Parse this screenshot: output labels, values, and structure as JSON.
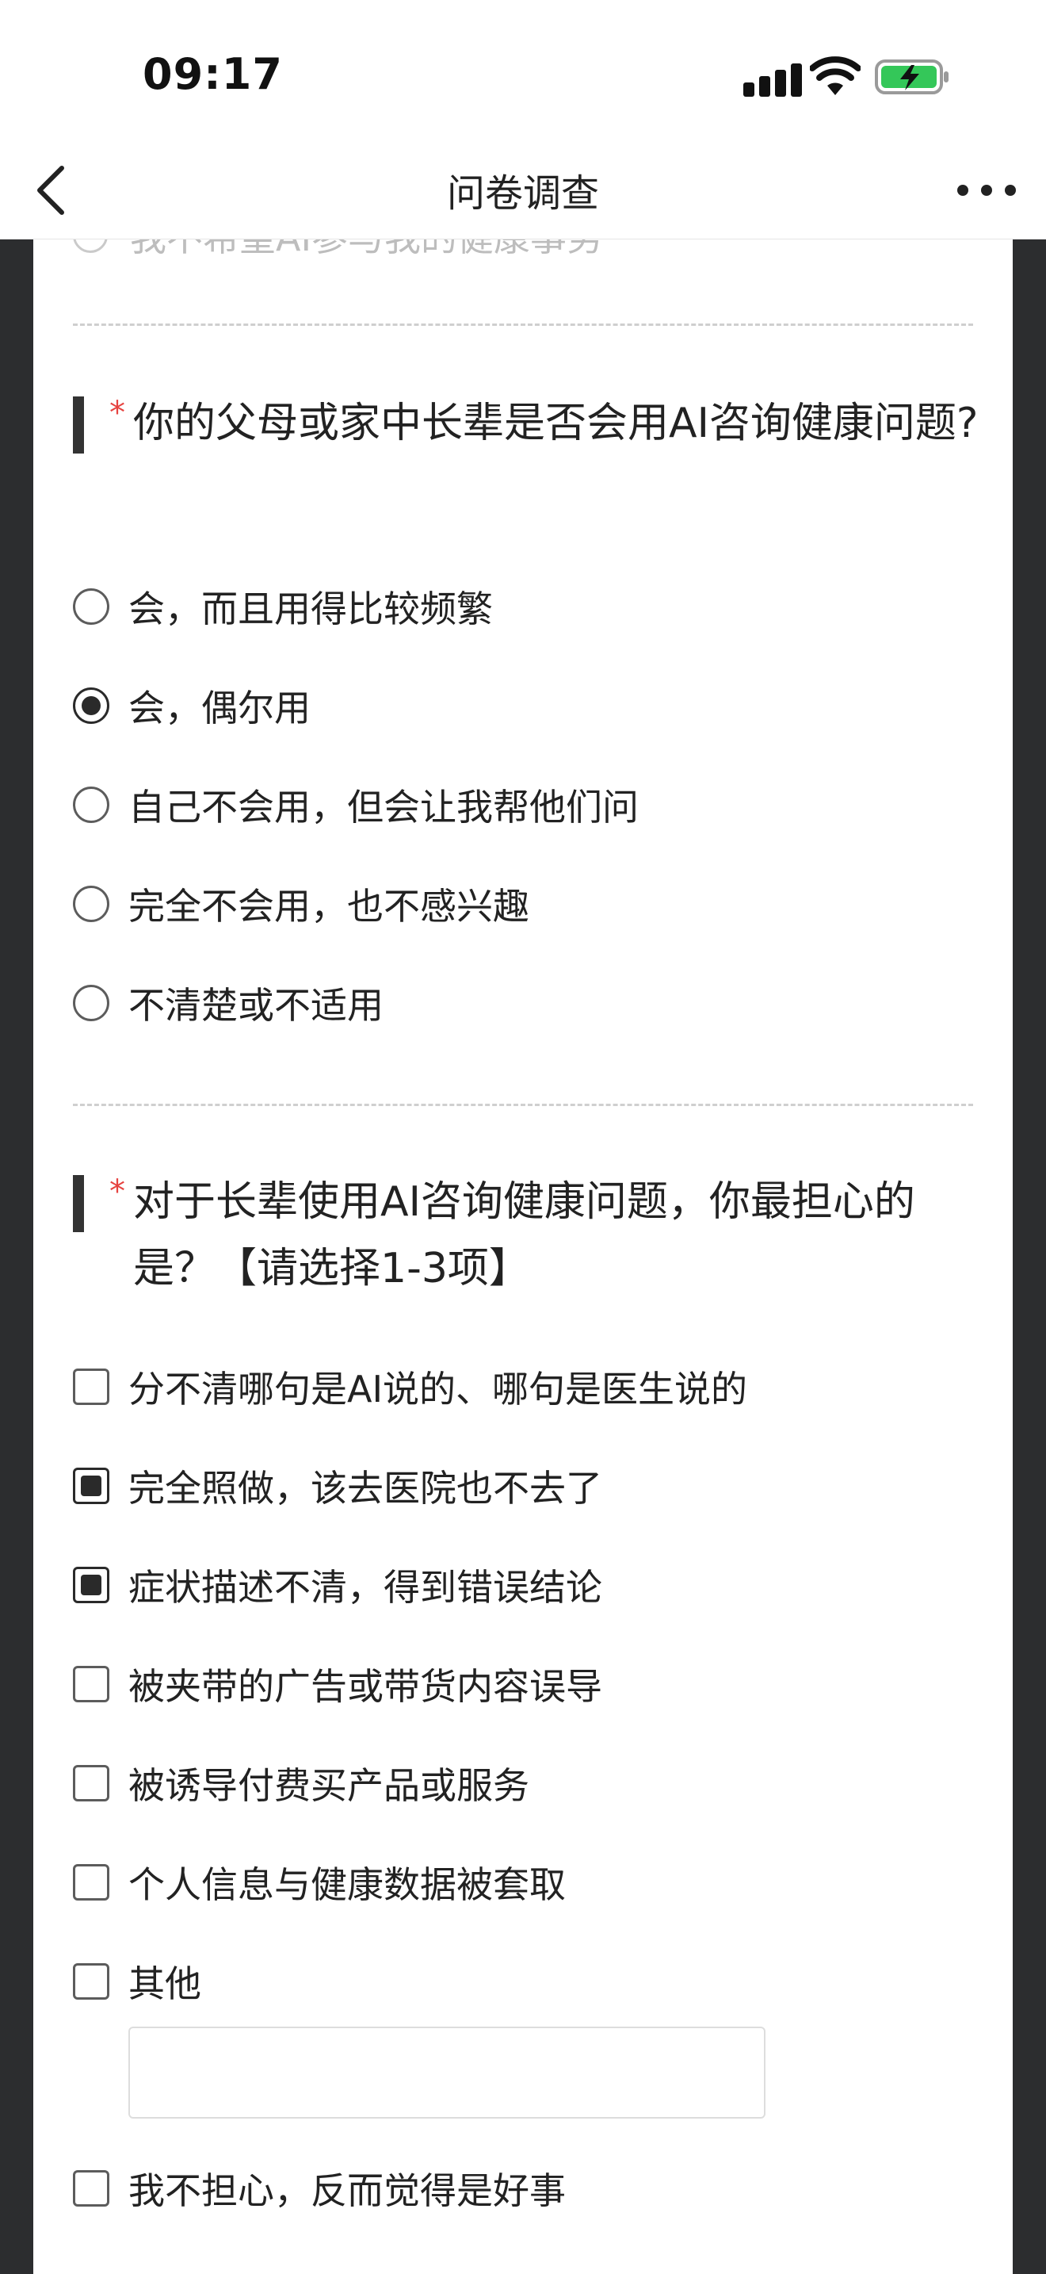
{
  "status_bar": {
    "time": "09:17"
  },
  "nav": {
    "title": "问卷调查"
  },
  "previous_option_partial": "我不希望AI参与我的健康事务",
  "questions": [
    {
      "required_mark": "*",
      "title": "你的父母或家中长辈是否会用AI咨询健康问题?",
      "type": "single",
      "options": [
        {
          "label": "会，而且用得比较频繁",
          "selected": false
        },
        {
          "label": "会，偶尔用",
          "selected": true
        },
        {
          "label": "自己不会用，但会让我帮他们问",
          "selected": false
        },
        {
          "label": "完全不会用，也不感兴趣",
          "selected": false
        },
        {
          "label": "不清楚或不适用",
          "selected": false
        }
      ]
    },
    {
      "required_mark": "*",
      "title": "对于长辈使用AI咨询健康问题，你最担心的是？【请选择1-3项】",
      "type": "multiple",
      "options": [
        {
          "label": "分不清哪句是AI说的、哪句是医生说的",
          "selected": false
        },
        {
          "label": "完全照做，该去医院也不去了",
          "selected": true
        },
        {
          "label": "症状描述不清，得到错误结论",
          "selected": true
        },
        {
          "label": "被夹带的广告或带货内容误导",
          "selected": false
        },
        {
          "label": "被诱导付费买产品或服务",
          "selected": false
        },
        {
          "label": "个人信息与健康数据被套取",
          "selected": false
        },
        {
          "label": "其他",
          "selected": false,
          "other_input_value": ""
        },
        {
          "label": "我不担心，反而觉得是好事",
          "selected": false
        }
      ]
    }
  ],
  "colors": {
    "frame": "#2c2d2f",
    "required": "#e64340",
    "checked": "#2a2a2a"
  }
}
